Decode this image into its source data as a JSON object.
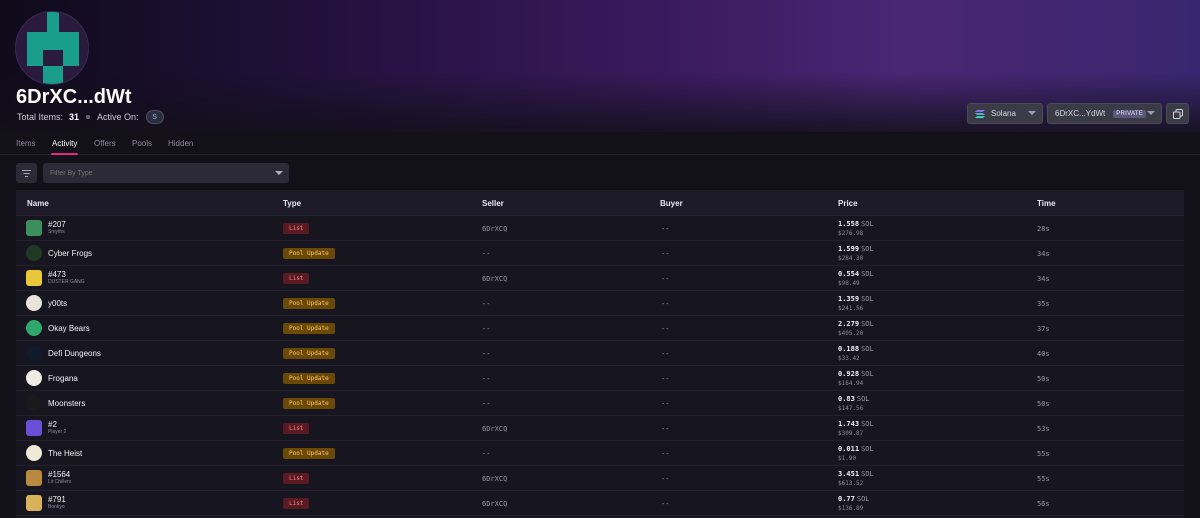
{
  "profile": {
    "wallet_name": "6DrXC...dWt",
    "total_items_label": "Total Items:",
    "total_items_value": "31",
    "active_on_label": "Active On:",
    "active_chain_badge": "S",
    "avatar_color": "#1a9e8c"
  },
  "controls": {
    "chain_select": "Solana",
    "wallet_select": "6DrXC...YdWt",
    "wallet_tag": "PRIVATE",
    "copy_icon": "copy-icon"
  },
  "tabs": [
    {
      "label": "Items",
      "active": false
    },
    {
      "label": "Activity",
      "active": true
    },
    {
      "label": "Offers",
      "active": false
    },
    {
      "label": "Pools",
      "active": false
    },
    {
      "label": "Hidden",
      "active": false
    }
  ],
  "filter": {
    "placeholder": "Filter By Type",
    "filter_icon": "filter-icon"
  },
  "table": {
    "headers": {
      "name": "Name",
      "type": "Type",
      "seller": "Seller",
      "buyer": "Buyer",
      "price": "Price",
      "time": "Time"
    },
    "rows": [
      {
        "name": "#207",
        "sub": "Smyths",
        "type": "List",
        "seller": "6DrXCQ",
        "buyer": "--",
        "price": "1.558",
        "unit": "SOL",
        "usd": "$276.98",
        "time": "28s",
        "thumb": "#3a8f5c",
        "round": false
      },
      {
        "name": "Cyber Frogs",
        "sub": "",
        "type": "Pool Update",
        "seller": "--",
        "buyer": "--",
        "price": "1.599",
        "unit": "SOL",
        "usd": "$284.30",
        "time": "34s",
        "thumb": "#1f3a24",
        "round": true
      },
      {
        "name": "#473",
        "sub": "DUSTER GANG",
        "type": "List",
        "seller": "6DrXCQ",
        "buyer": "--",
        "price": "0.554",
        "unit": "SOL",
        "usd": "$98.49",
        "time": "34s",
        "thumb": "#e8c83a",
        "round": false
      },
      {
        "name": "y00ts",
        "sub": "",
        "type": "Pool Update",
        "seller": "--",
        "buyer": "--",
        "price": "1.359",
        "unit": "SOL",
        "usd": "$241.56",
        "time": "35s",
        "thumb": "#e9e4da",
        "round": true
      },
      {
        "name": "Okay Bears",
        "sub": "",
        "type": "Pool Update",
        "seller": "--",
        "buyer": "--",
        "price": "2.279",
        "unit": "SOL",
        "usd": "$405.20",
        "time": "37s",
        "thumb": "#2fa86b",
        "round": true
      },
      {
        "name": "Defi Dungeons",
        "sub": "",
        "type": "Pool Update",
        "seller": "--",
        "buyer": "--",
        "price": "0.188",
        "unit": "SOL",
        "usd": "$33.42",
        "time": "40s",
        "thumb": "#0f1a2a",
        "round": true
      },
      {
        "name": "Frogana",
        "sub": "",
        "type": "Pool Update",
        "seller": "--",
        "buyer": "--",
        "price": "0.928",
        "unit": "SOL",
        "usd": "$164.94",
        "time": "50s",
        "thumb": "#f0ece2",
        "round": true
      },
      {
        "name": "Moonsters",
        "sub": "",
        "type": "Pool Update",
        "seller": "--",
        "buyer": "--",
        "price": "0.83",
        "unit": "SOL",
        "usd": "$147.56",
        "time": "50s",
        "thumb": "#1a1a1e",
        "round": true
      },
      {
        "name": "#2",
        "sub": "Player 2",
        "type": "List",
        "seller": "6DrXCQ",
        "buyer": "--",
        "price": "1.743",
        "unit": "SOL",
        "usd": "$309.87",
        "time": "53s",
        "thumb": "#6a4fd6",
        "round": false
      },
      {
        "name": "The Heist",
        "sub": "",
        "type": "Pool Update",
        "seller": "--",
        "buyer": "--",
        "price": "0.011",
        "unit": "SOL",
        "usd": "$1.90",
        "time": "55s",
        "thumb": "#efe9d8",
        "round": true
      },
      {
        "name": "#1564",
        "sub": "Lit Chillers",
        "type": "List",
        "seller": "6DrXCQ",
        "buyer": "--",
        "price": "3.451",
        "unit": "SOL",
        "usd": "$613.52",
        "time": "55s",
        "thumb": "#b98a3e",
        "round": false
      },
      {
        "name": "#791",
        "sub": "Bonkyo",
        "type": "List",
        "seller": "6DrXCQ",
        "buyer": "--",
        "price": "0.77",
        "unit": "SOL",
        "usd": "$136.89",
        "time": "56s",
        "thumb": "#d8b25a",
        "round": false
      }
    ]
  }
}
